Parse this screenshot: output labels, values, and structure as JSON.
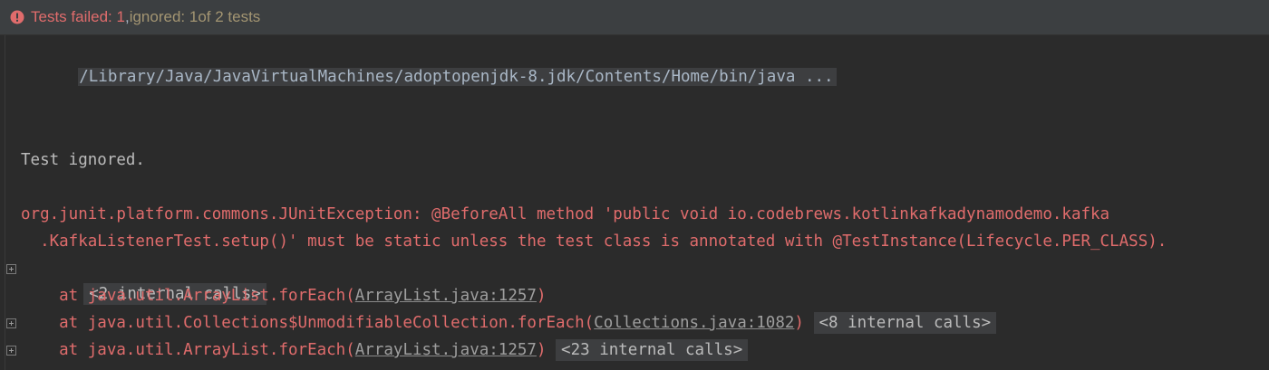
{
  "status": {
    "icon": "error-icon",
    "failed_text": "Tests failed: 1",
    "separator": ", ",
    "ignored_text": "ignored: 1",
    "rest_text": " of 2 tests",
    "colors": {
      "failed": "#e06c6c",
      "ignored": "#a39572"
    }
  },
  "console": {
    "command_line": "/Library/Java/JavaVirtualMachines/adoptopenjdk-8.jdk/Contents/Home/bin/java ...",
    "test_ignored": "Test ignored.",
    "exception_line1": "org.junit.platform.commons.JUnitException: @BeforeAll method 'public void io.codebrews.kotlinkafkadynamodemo.kafka",
    "exception_line2": "  .KafkaListenerTest.setup()' must be static unless the test class is annotated with @TestInstance(Lifecycle.PER_CLASS).",
    "internal_calls_1": "<2 internal calls>",
    "frames": [
      {
        "prefix": "    at java.util.ArrayList.forEach(",
        "link": "ArrayList.java:1257",
        "suffix": ")",
        "fold": ""
      },
      {
        "prefix": "    at java.util.Collections$UnmodifiableCollection.forEach(",
        "link": "Collections.java:1082",
        "suffix": ")",
        "fold": "<8 internal calls>"
      },
      {
        "prefix": "    at java.util.ArrayList.forEach(",
        "link": "ArrayList.java:1257",
        "suffix": ")",
        "fold": "<23 internal calls>"
      }
    ],
    "colors": {
      "error": "#e06c6c",
      "text": "#bbbbbb",
      "background": "#2b2b2b"
    }
  }
}
